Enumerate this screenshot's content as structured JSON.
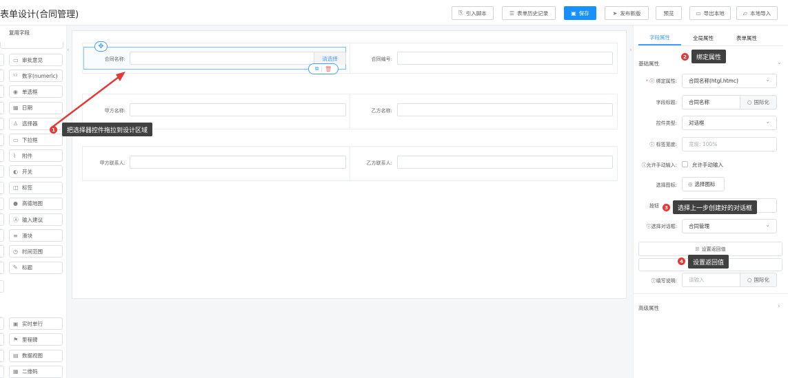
{
  "app": {
    "title": "表单设计(合同管理)"
  },
  "toolbar": {
    "import_script": "引入脚本",
    "history": "表单历史记录",
    "save": "保存",
    "publish": "发布新版",
    "preview": "预览",
    "export_local": "导出本地",
    "import_local": "本地导入"
  },
  "left": {
    "header": "复用字段",
    "components": [
      {
        "label": "审批意见",
        "icon": "comment-box-icon"
      },
      {
        "label": "数字(numeric)",
        "icon": "number-icon"
      },
      {
        "label": "单选框",
        "icon": "radio-icon"
      },
      {
        "label": "日期",
        "icon": "calendar-icon"
      },
      {
        "label": "选择器",
        "icon": "user-picker-icon"
      },
      {
        "label": "下拉框",
        "icon": "dropdown-icon"
      },
      {
        "label": "附件",
        "icon": "paperclip-icon"
      },
      {
        "label": "开关",
        "icon": "switch-icon"
      },
      {
        "label": "标签",
        "icon": "tag-icon"
      },
      {
        "label": "高德地图",
        "icon": "map-pin-icon"
      },
      {
        "label": "输入建议",
        "icon": "suggest-icon"
      },
      {
        "label": "滑块",
        "icon": "slider-icon"
      },
      {
        "label": "时间范围",
        "icon": "clock-icon"
      },
      {
        "label": "标题",
        "icon": "title-icon"
      }
    ],
    "components2": [
      {
        "label": "实时单行",
        "icon": "realtime-icon"
      },
      {
        "label": "里程碑",
        "icon": "flag-icon"
      },
      {
        "label": "数据视图",
        "icon": "data-view-icon"
      },
      {
        "label": "二维码",
        "icon": "qrcode-icon"
      }
    ]
  },
  "canvas": {
    "rows": [
      {
        "left_label": "合同名称:",
        "right_label": "合同编号:"
      },
      {
        "left_label": "甲方名称:",
        "right_label": "乙方名称:"
      },
      {
        "left_label": "甲方联系人:",
        "right_label": "乙方联系人:"
      }
    ],
    "select_button": "请选择"
  },
  "right": {
    "tabs": [
      "字段属性",
      "全局属性",
      "表单属性"
    ],
    "active_tab": 0,
    "basic_section": "基础属性",
    "advanced_section": "高级属性",
    "props": {
      "bind_label": "绑定属性:",
      "bind_value": "合同名称(htgl.htmc)",
      "title_label": "字段标题:",
      "title_value": "合同名称",
      "i18n": "国际化",
      "type_label": "控件类型:",
      "type_value": "对话框",
      "width_label": "标签宽度:",
      "width_placeholder": "宽度: 100%",
      "manual_label": "允许手动输入:",
      "manual_text": "允许手动输入",
      "icon_label": "选择图标:",
      "icon_btn": "选择图标",
      "btn_label": "按钮",
      "dialog_label": "选择对话框:",
      "dialog_value": "合同管理",
      "return_btn": "设置返回值",
      "desc_label": "填写说明:",
      "desc_placeholder": "请输入"
    }
  },
  "annotations": [
    {
      "num": "1",
      "text": "把选择器控件拖拉到设计区域"
    },
    {
      "num": "2",
      "text": "绑定属性"
    },
    {
      "num": "3",
      "text": "选择上一步创建好的对话框"
    },
    {
      "num": "4",
      "text": "设置返回值"
    }
  ],
  "colors": {
    "primary": "#1890ff",
    "annotation": "#e53935",
    "tooltip": "#404040"
  }
}
